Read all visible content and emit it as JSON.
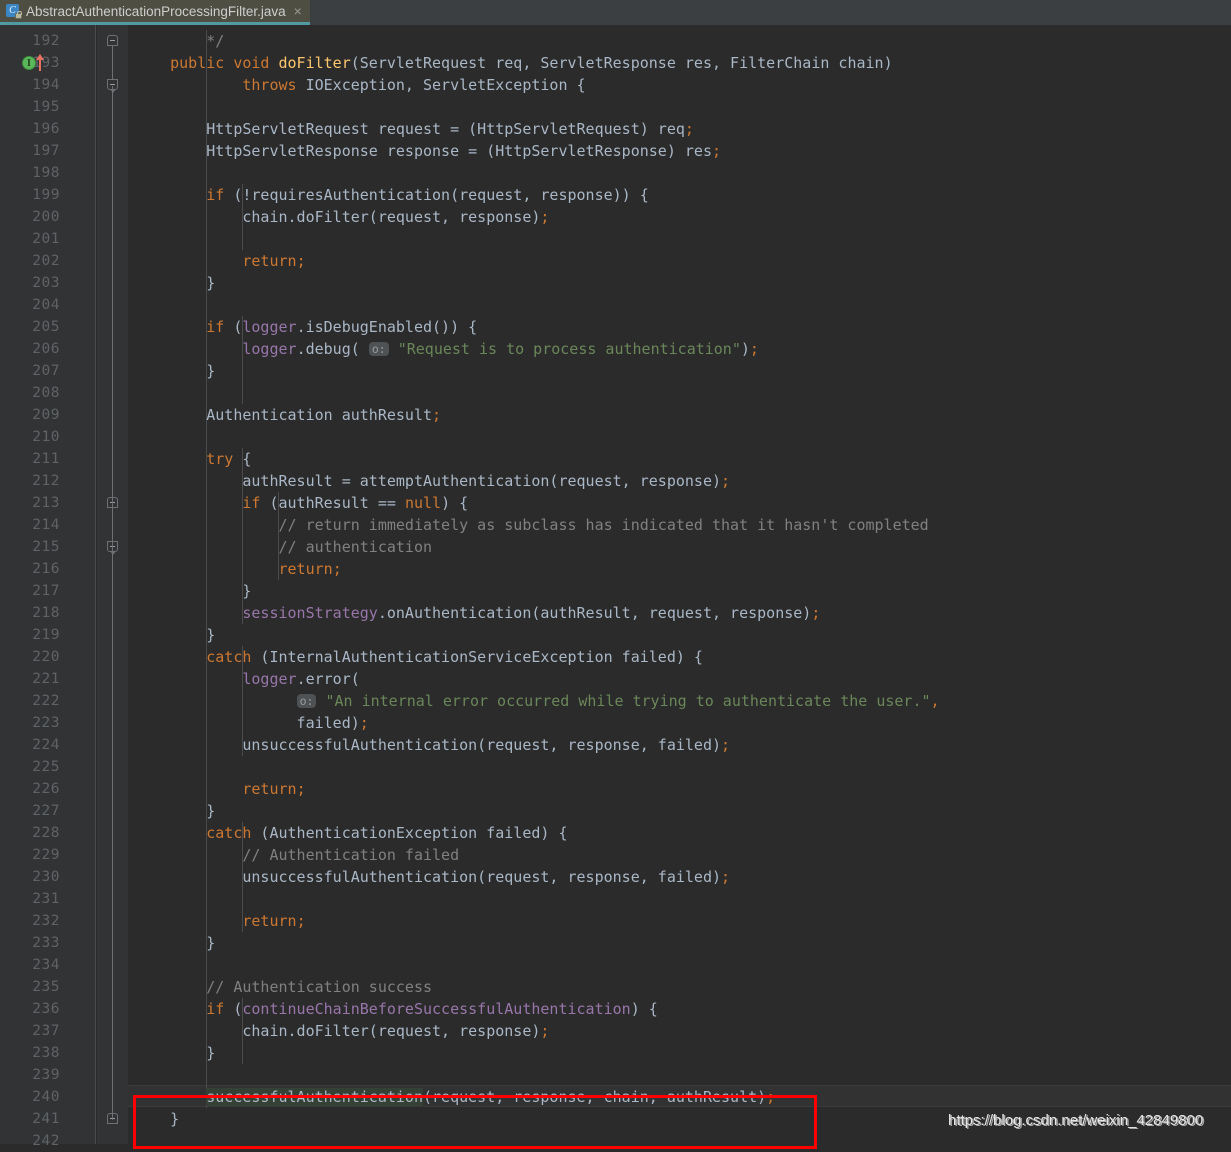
{
  "window": {
    "title": "AbstractAuthenticationProcessingFilter.java"
  },
  "tab": {
    "label": "AbstractAuthenticationProcessingFilter.java",
    "close_label": "×",
    "icon": "java-class-locked-icon",
    "icon_letter": "C",
    "accent_color": "#4f9aa3",
    "active_bg": "#4e4f42"
  },
  "theme": {
    "editor_bg": "#2b2b2b",
    "gutter_bg": "#313335",
    "tabbar_bg": "#3c3f41",
    "default_text": "#a9b7c6",
    "keyword": "#cc7832",
    "string": "#6a8759",
    "comment": "#808080",
    "field": "#9876aa",
    "method": "#ffc66d",
    "number": "#6897bb",
    "line_number": "#606366",
    "caret_row_bg": "#323232",
    "identifier_highlight_bg": "#344134",
    "annotation_red": "#ff0000"
  },
  "gutter": {
    "first_line": 192,
    "last_line": 242,
    "icons": [
      {
        "line": 193,
        "name": "implementing-method-icon",
        "letter": "I",
        "has_override_arrow": true
      }
    ],
    "line_numbers": [
      "192",
      "193",
      "194",
      "195",
      "196",
      "197",
      "198",
      "199",
      "200",
      "201",
      "202",
      "203",
      "204",
      "205",
      "206",
      "207",
      "208",
      "209",
      "210",
      "211",
      "212",
      "213",
      "214",
      "215",
      "216",
      "217",
      "218",
      "219",
      "220",
      "221",
      "222",
      "223",
      "224",
      "225",
      "226",
      "227",
      "228",
      "229",
      "230",
      "231",
      "232",
      "233",
      "234",
      "235",
      "236",
      "237",
      "238",
      "239",
      "240",
      "241",
      "242"
    ]
  },
  "code": {
    "caret_line_index": 48,
    "lines": [
      {
        "n": "192",
        "tokens": [
          {
            "t": "        ",
            "c": "pun"
          },
          {
            "t": "*/",
            "c": "cmt"
          }
        ]
      },
      {
        "n": "193",
        "tokens": [
          {
            "t": "    ",
            "c": "pun"
          },
          {
            "t": "public",
            "c": "kw"
          },
          {
            "t": " ",
            "c": "pun"
          },
          {
            "t": "void",
            "c": "kw"
          },
          {
            "t": " ",
            "c": "pun"
          },
          {
            "t": "doFilter",
            "c": "mth"
          },
          {
            "t": "(ServletRequest req, ServletResponse res, FilterChain chain)",
            "c": "cls"
          }
        ]
      },
      {
        "n": "194",
        "tokens": [
          {
            "t": "            ",
            "c": "pun"
          },
          {
            "t": "throws",
            "c": "kw"
          },
          {
            "t": " IOException, ServletException {",
            "c": "cls"
          }
        ]
      },
      {
        "n": "195",
        "tokens": []
      },
      {
        "n": "196",
        "tokens": [
          {
            "t": "        HttpServletRequest request = (HttpServletRequest) req",
            "c": "cls"
          },
          {
            "t": ";",
            "c": "semi"
          }
        ]
      },
      {
        "n": "197",
        "tokens": [
          {
            "t": "        HttpServletResponse response = (HttpServletResponse) res",
            "c": "cls"
          },
          {
            "t": ";",
            "c": "semi"
          }
        ]
      },
      {
        "n": "198",
        "tokens": []
      },
      {
        "n": "199",
        "tokens": [
          {
            "t": "        ",
            "c": "pun"
          },
          {
            "t": "if",
            "c": "kw"
          },
          {
            "t": " (!requiresAuthentication(request, response)) {",
            "c": "cls"
          }
        ]
      },
      {
        "n": "200",
        "tokens": [
          {
            "t": "            chain.doFilter(request, response)",
            "c": "cls"
          },
          {
            "t": ";",
            "c": "semi"
          }
        ]
      },
      {
        "n": "201",
        "tokens": []
      },
      {
        "n": "202",
        "tokens": [
          {
            "t": "            ",
            "c": "pun"
          },
          {
            "t": "return",
            "c": "kw"
          },
          {
            "t": ";",
            "c": "semi"
          }
        ]
      },
      {
        "n": "203",
        "tokens": [
          {
            "t": "        }",
            "c": "cls"
          }
        ]
      },
      {
        "n": "204",
        "tokens": []
      },
      {
        "n": "205",
        "tokens": [
          {
            "t": "        ",
            "c": "pun"
          },
          {
            "t": "if",
            "c": "kw"
          },
          {
            "t": " (",
            "c": "cls"
          },
          {
            "t": "logger",
            "c": "fld"
          },
          {
            "t": ".isDebugEnabled()) {",
            "c": "cls"
          }
        ]
      },
      {
        "n": "206",
        "tokens": [
          {
            "t": "            ",
            "c": "pun"
          },
          {
            "t": "logger",
            "c": "fld"
          },
          {
            "t": ".debug(",
            "c": "cls"
          },
          {
            "t": " ",
            "c": "pun"
          },
          {
            "t": "o:",
            "c": "hint"
          },
          {
            "t": " ",
            "c": "pun"
          },
          {
            "t": "\"Request is to process authentication\"",
            "c": "str"
          },
          {
            "t": ")",
            "c": "cls"
          },
          {
            "t": ";",
            "c": "semi"
          }
        ]
      },
      {
        "n": "207",
        "tokens": [
          {
            "t": "        }",
            "c": "cls"
          }
        ]
      },
      {
        "n": "208",
        "tokens": []
      },
      {
        "n": "209",
        "tokens": [
          {
            "t": "        Authentication authResult",
            "c": "cls"
          },
          {
            "t": ";",
            "c": "semi"
          }
        ]
      },
      {
        "n": "210",
        "tokens": []
      },
      {
        "n": "211",
        "tokens": [
          {
            "t": "        ",
            "c": "pun"
          },
          {
            "t": "try",
            "c": "kw"
          },
          {
            "t": " {",
            "c": "cls"
          }
        ]
      },
      {
        "n": "212",
        "tokens": [
          {
            "t": "            authResult = attemptAuthentication(request, response)",
            "c": "cls"
          },
          {
            "t": ";",
            "c": "semi"
          }
        ]
      },
      {
        "n": "213",
        "tokens": [
          {
            "t": "            ",
            "c": "pun"
          },
          {
            "t": "if",
            "c": "kw"
          },
          {
            "t": " (authResult == ",
            "c": "cls"
          },
          {
            "t": "null",
            "c": "kw"
          },
          {
            "t": ") {",
            "c": "cls"
          }
        ]
      },
      {
        "n": "214",
        "tokens": [
          {
            "t": "                // return immediately as subclass has indicated that it hasn't completed",
            "c": "cmt"
          }
        ]
      },
      {
        "n": "215",
        "tokens": [
          {
            "t": "                // authentication",
            "c": "cmt"
          }
        ]
      },
      {
        "n": "216",
        "tokens": [
          {
            "t": "                ",
            "c": "pun"
          },
          {
            "t": "return",
            "c": "kw"
          },
          {
            "t": ";",
            "c": "semi"
          }
        ]
      },
      {
        "n": "217",
        "tokens": [
          {
            "t": "            }",
            "c": "cls"
          }
        ]
      },
      {
        "n": "218",
        "tokens": [
          {
            "t": "            ",
            "c": "pun"
          },
          {
            "t": "sessionStrategy",
            "c": "fld"
          },
          {
            "t": ".onAuthentication(authResult, request, response)",
            "c": "cls"
          },
          {
            "t": ";",
            "c": "semi"
          }
        ]
      },
      {
        "n": "219",
        "tokens": [
          {
            "t": "        }",
            "c": "cls"
          }
        ]
      },
      {
        "n": "220",
        "tokens": [
          {
            "t": "        ",
            "c": "pun"
          },
          {
            "t": "catch",
            "c": "kw"
          },
          {
            "t": " (InternalAuthenticationServiceException failed) {",
            "c": "cls"
          }
        ]
      },
      {
        "n": "221",
        "tokens": [
          {
            "t": "            ",
            "c": "pun"
          },
          {
            "t": "logger",
            "c": "fld"
          },
          {
            "t": ".error(",
            "c": "cls"
          }
        ]
      },
      {
        "n": "222",
        "tokens": [
          {
            "t": "                  ",
            "c": "pun"
          },
          {
            "t": "o:",
            "c": "hint"
          },
          {
            "t": " ",
            "c": "pun"
          },
          {
            "t": "\"An internal error occurred while trying to authenticate the user.\"",
            "c": "str"
          },
          {
            "t": ",",
            "c": "semi"
          }
        ]
      },
      {
        "n": "223",
        "tokens": [
          {
            "t": "                  failed)",
            "c": "cls"
          },
          {
            "t": ";",
            "c": "semi"
          }
        ]
      },
      {
        "n": "224",
        "tokens": [
          {
            "t": "            unsuccessfulAuthentication(request, response, failed)",
            "c": "cls"
          },
          {
            "t": ";",
            "c": "semi"
          }
        ]
      },
      {
        "n": "225",
        "tokens": []
      },
      {
        "n": "226",
        "tokens": [
          {
            "t": "            ",
            "c": "pun"
          },
          {
            "t": "return",
            "c": "kw"
          },
          {
            "t": ";",
            "c": "semi"
          }
        ]
      },
      {
        "n": "227",
        "tokens": [
          {
            "t": "        }",
            "c": "cls"
          }
        ]
      },
      {
        "n": "228",
        "tokens": [
          {
            "t": "        ",
            "c": "pun"
          },
          {
            "t": "catch",
            "c": "kw"
          },
          {
            "t": " (AuthenticationException failed) {",
            "c": "cls"
          }
        ]
      },
      {
        "n": "229",
        "tokens": [
          {
            "t": "            // Authentication failed",
            "c": "cmt"
          }
        ]
      },
      {
        "n": "230",
        "tokens": [
          {
            "t": "            unsuccessfulAuthentication(request, response, failed)",
            "c": "cls"
          },
          {
            "t": ";",
            "c": "semi"
          }
        ]
      },
      {
        "n": "231",
        "tokens": []
      },
      {
        "n": "232",
        "tokens": [
          {
            "t": "            ",
            "c": "pun"
          },
          {
            "t": "return",
            "c": "kw"
          },
          {
            "t": ";",
            "c": "semi"
          }
        ]
      },
      {
        "n": "233",
        "tokens": [
          {
            "t": "        }",
            "c": "cls"
          }
        ]
      },
      {
        "n": "234",
        "tokens": []
      },
      {
        "n": "235",
        "tokens": [
          {
            "t": "        // Authentication success",
            "c": "cmt"
          }
        ]
      },
      {
        "n": "236",
        "tokens": [
          {
            "t": "        ",
            "c": "pun"
          },
          {
            "t": "if",
            "c": "kw"
          },
          {
            "t": " (",
            "c": "cls"
          },
          {
            "t": "continueChainBeforeSuccessfulAuthentication",
            "c": "fld"
          },
          {
            "t": ") {",
            "c": "cls"
          }
        ]
      },
      {
        "n": "237",
        "tokens": [
          {
            "t": "            chain.doFilter(request, response)",
            "c": "cls"
          },
          {
            "t": ";",
            "c": "semi"
          }
        ]
      },
      {
        "n": "238",
        "tokens": [
          {
            "t": "        }",
            "c": "cls"
          }
        ]
      },
      {
        "n": "239",
        "tokens": []
      },
      {
        "n": "240",
        "tokens": [
          {
            "t": "        ",
            "c": "pun"
          },
          {
            "t": "successfulAuthentication",
            "c": "hl"
          },
          {
            "t": "(request, response, chain, authResult)",
            "c": "cls"
          },
          {
            "t": ";",
            "c": "semi"
          }
        ]
      },
      {
        "n": "241",
        "tokens": [
          {
            "t": "    }",
            "c": "cls"
          }
        ]
      },
      {
        "n": "242",
        "tokens": []
      }
    ]
  },
  "annotation": {
    "type": "red-rectangle-highlight",
    "target_line": "240",
    "color": "#ff0000"
  },
  "watermark": {
    "text": "https://blog.csdn.net/weixin_42849800"
  }
}
